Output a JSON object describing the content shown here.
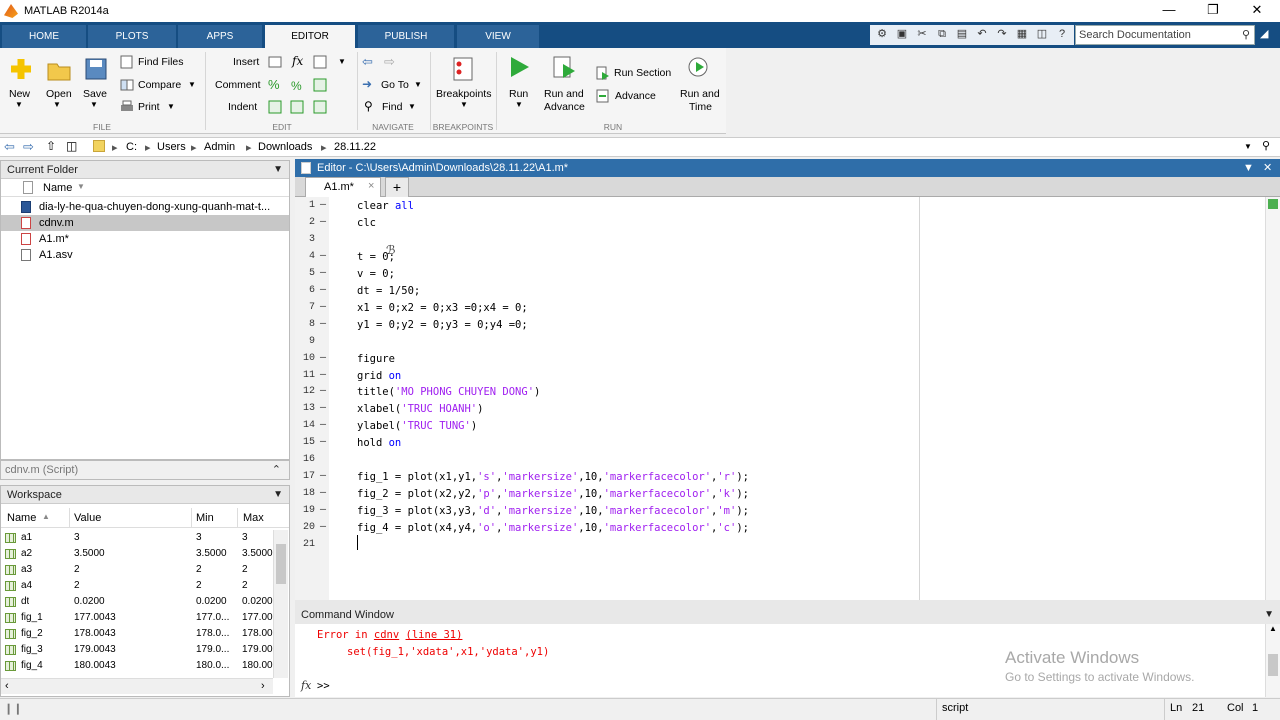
{
  "window": {
    "title": "MATLAB R2014a"
  },
  "tabs": [
    "HOME",
    "PLOTS",
    "APPS",
    "EDITOR",
    "PUBLISH",
    "VIEW"
  ],
  "search": {
    "placeholder": "Search Documentation"
  },
  "ribbon": {
    "file": {
      "new": "New",
      "open": "Open",
      "save": "Save",
      "find_files": "Find Files",
      "compare": "Compare",
      "print": "Print",
      "section": "FILE"
    },
    "edit": {
      "insert": "Insert",
      "comment": "Comment",
      "indent": "Indent",
      "fx": "fx",
      "section": "EDIT"
    },
    "navigate": {
      "go_to": "Go To",
      "find": "Find",
      "section": "NAVIGATE"
    },
    "breakpoints": {
      "breakpoints": "Breakpoints",
      "section": "BREAKPOINTS"
    },
    "run": {
      "run": "Run",
      "run_advance_1": "Run and",
      "run_advance_2": "Advance",
      "run_section": "Run Section",
      "advance": "Advance",
      "run_time_1": "Run and",
      "run_time_2": "Time",
      "section": "RUN"
    }
  },
  "address": [
    "C:",
    "Users",
    "Admin",
    "Downloads",
    "28.11.22"
  ],
  "current_folder": {
    "title": "Current Folder",
    "col_name": "Name",
    "files": [
      "dia-ly-he-qua-chuyen-dong-xung-quanh-mat-t...",
      "cdnv.m",
      "A1.m*",
      "A1.asv"
    ],
    "detail": "cdnv.m (Script)"
  },
  "workspace": {
    "title": "Workspace",
    "columns": [
      "Name",
      "Value",
      "Min",
      "Max"
    ],
    "rows": [
      {
        "name": "a1",
        "value": "3",
        "min": "3",
        "max": "3"
      },
      {
        "name": "a2",
        "value": "3.5000",
        "min": "3.5000",
        "max": "3.5000"
      },
      {
        "name": "a3",
        "value": "2",
        "min": "2",
        "max": "2"
      },
      {
        "name": "a4",
        "value": "2",
        "min": "2",
        "max": "2"
      },
      {
        "name": "dt",
        "value": "0.0200",
        "min": "0.0200",
        "max": "0.0200"
      },
      {
        "name": "fig_1",
        "value": "177.0043",
        "min": "177.0...",
        "max": "177.00"
      },
      {
        "name": "fig_2",
        "value": "178.0043",
        "min": "178.0...",
        "max": "178.00"
      },
      {
        "name": "fig_3",
        "value": "179.0043",
        "min": "179.0...",
        "max": "179.00"
      },
      {
        "name": "fig_4",
        "value": "180.0043",
        "min": "180.0...",
        "max": "180.00"
      }
    ]
  },
  "editor": {
    "title": "Editor - C:\\Users\\Admin\\Downloads\\28.11.22\\A1.m*",
    "tab": "A1.m*",
    "lines": [
      "clear all",
      "clc",
      "",
      "t = 0;",
      "v = 0;",
      "dt = 1/50;",
      "x1 = 0;x2 = 0;x3 =0;x4 = 0;",
      "y1 = 0;y2 = 0;y3 = 0;y4 =0;",
      "",
      "figure",
      "grid on",
      "title('MO PHONG CHUYEN DONG')",
      "xlabel('TRUC HOANH')",
      "ylabel('TRUC TUNG')",
      "hold on",
      "",
      "fig_1 = plot(x1,y1,'s','markersize',10,'markerfacecolor','r');",
      "fig_2 = plot(x2,y2,'p','markersize',10,'markerfacecolor','k');",
      "fig_3 = plot(x3,y3,'d','markersize',10,'markerfacecolor','m');",
      "fig_4 = plot(x4,y4,'o','markersize',10,'markerfacecolor','c');",
      ""
    ]
  },
  "command_window": {
    "title": "Command Window",
    "error_prefix": "Error in ",
    "error_file": "cdnv",
    "error_line": "(line 31)",
    "error_code": "set(fig_1,'xdata',x1,'ydata',y1)",
    "prompt": ">>",
    "fx": "fx"
  },
  "watermark": {
    "line1": "Activate Windows",
    "line2": "Go to Settings to activate Windows."
  },
  "status": {
    "mode": "script",
    "ln_label": "Ln",
    "ln": "21",
    "col_label": "Col",
    "col": "1"
  }
}
